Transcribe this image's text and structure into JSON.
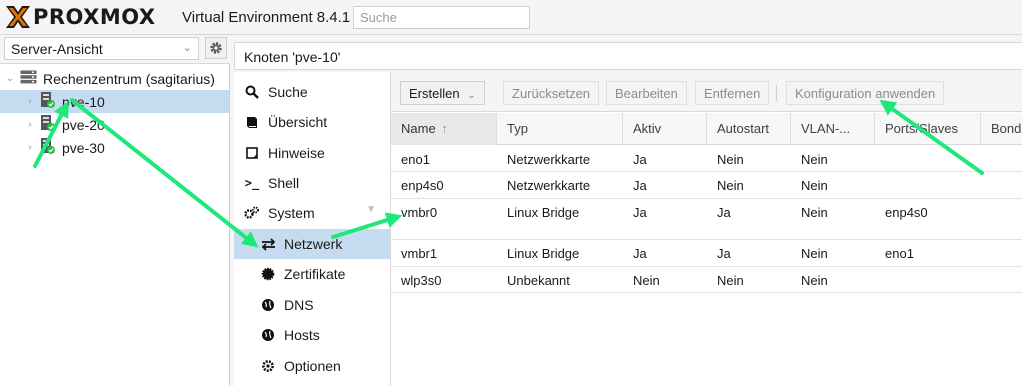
{
  "app": {
    "brand": "PROXMOX",
    "version_label": "Virtual Environment 8.4.1",
    "search_placeholder": "Suche"
  },
  "tree": {
    "view_select": "Server-Ansicht",
    "datacenter": "Rechenzentrum (sagitarius)",
    "nodes": [
      {
        "label": "pve-10",
        "selected": true
      },
      {
        "label": "pve-20",
        "selected": false
      },
      {
        "label": "pve-30",
        "selected": false
      }
    ]
  },
  "node_title": "Knoten 'pve-10'",
  "nav": [
    {
      "label": "Suche",
      "icon": "search-icon"
    },
    {
      "label": "Übersicht",
      "icon": "book-icon"
    },
    {
      "label": "Hinweise",
      "icon": "note-icon"
    },
    {
      "label": "Shell",
      "icon": "terminal-icon"
    },
    {
      "label": "System",
      "icon": "gears-icon"
    },
    {
      "label": "Netzwerk",
      "icon": "exchange-icon",
      "selected": true
    },
    {
      "label": "Zertifikate",
      "icon": "certificate-icon"
    },
    {
      "label": "DNS",
      "icon": "globe-icon"
    },
    {
      "label": "Hosts",
      "icon": "globe-icon"
    },
    {
      "label": "Optionen",
      "icon": "gear-icon"
    }
  ],
  "toolbar": {
    "create": "Erstellen",
    "revert": "Zurücksetzen",
    "edit": "Bearbeiten",
    "remove": "Entfernen",
    "apply": "Konfiguration anwenden"
  },
  "grid": {
    "columns": [
      "Name",
      "Typ",
      "Aktiv",
      "Autostart",
      "VLAN-...",
      "Ports/Slaves",
      "Bond"
    ],
    "rows": [
      [
        "eno1",
        "Netzwerkkarte",
        "Ja",
        "Nein",
        "Nein",
        "",
        ""
      ],
      [
        "enp4s0",
        "Netzwerkkarte",
        "Ja",
        "Nein",
        "Nein",
        "",
        ""
      ],
      [
        "vmbr0",
        "Linux Bridge",
        "Ja",
        "Ja",
        "Nein",
        "enp4s0",
        ""
      ],
      [
        "vmbr1",
        "Linux Bridge",
        "Ja",
        "Ja",
        "Nein",
        "eno1",
        ""
      ],
      [
        "wlp3s0",
        "Unbekannt",
        "Nein",
        "Nein",
        "Nein",
        "",
        ""
      ]
    ]
  },
  "colors": {
    "accent_selected": "#c5dcf0",
    "annotation_arrow": "#1ee87a",
    "logo_orange": "#e57000"
  }
}
